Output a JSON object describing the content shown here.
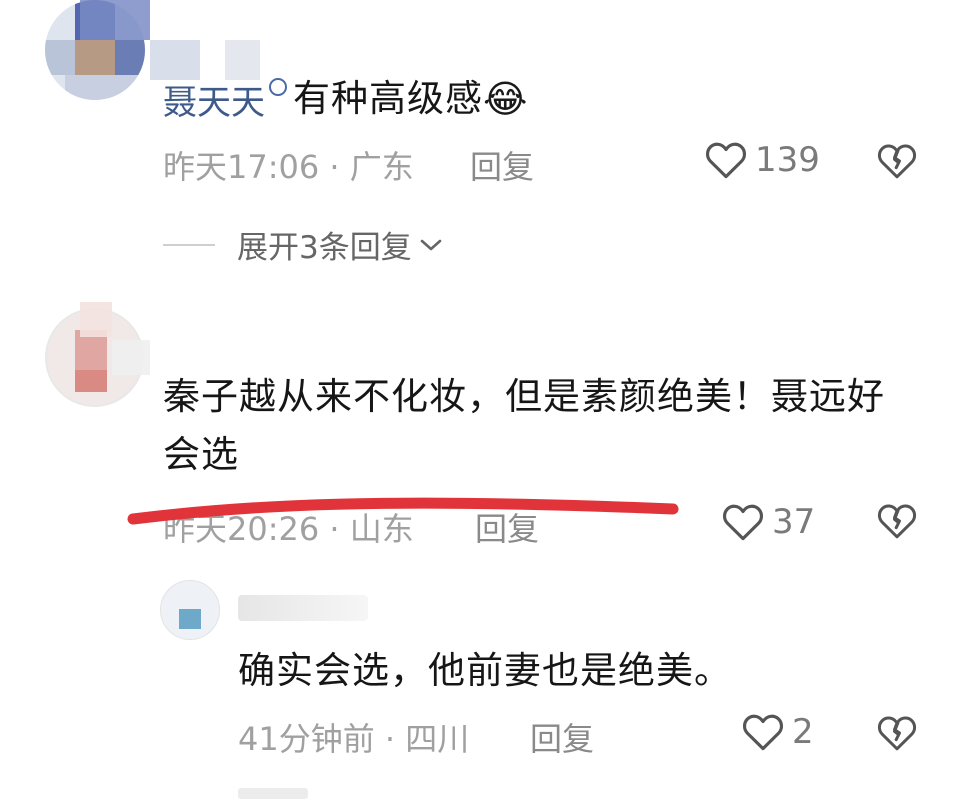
{
  "comments": [
    {
      "username": "聂天天",
      "text": "有种高级感",
      "emoji": "😂",
      "time_location": "昨天17:06 · 广东",
      "reply_label": "回复",
      "likes": "139",
      "expand_label": "展开3条回复"
    },
    {
      "text": "秦子越从来不化妆，但是素颜绝美！聂远好会选",
      "time_location": "昨天20:26 · 山东",
      "reply_label": "回复",
      "likes": "37"
    }
  ],
  "reply": {
    "text": "确实会选，他前妻也是绝美。",
    "time_location": "41分钟前 · 四川",
    "reply_label": "回复",
    "likes": "2"
  },
  "colors": {
    "meta_gray": "#a0a0a0",
    "username_blue": "#3d5a8a",
    "annotation_red": "#e0343a"
  }
}
